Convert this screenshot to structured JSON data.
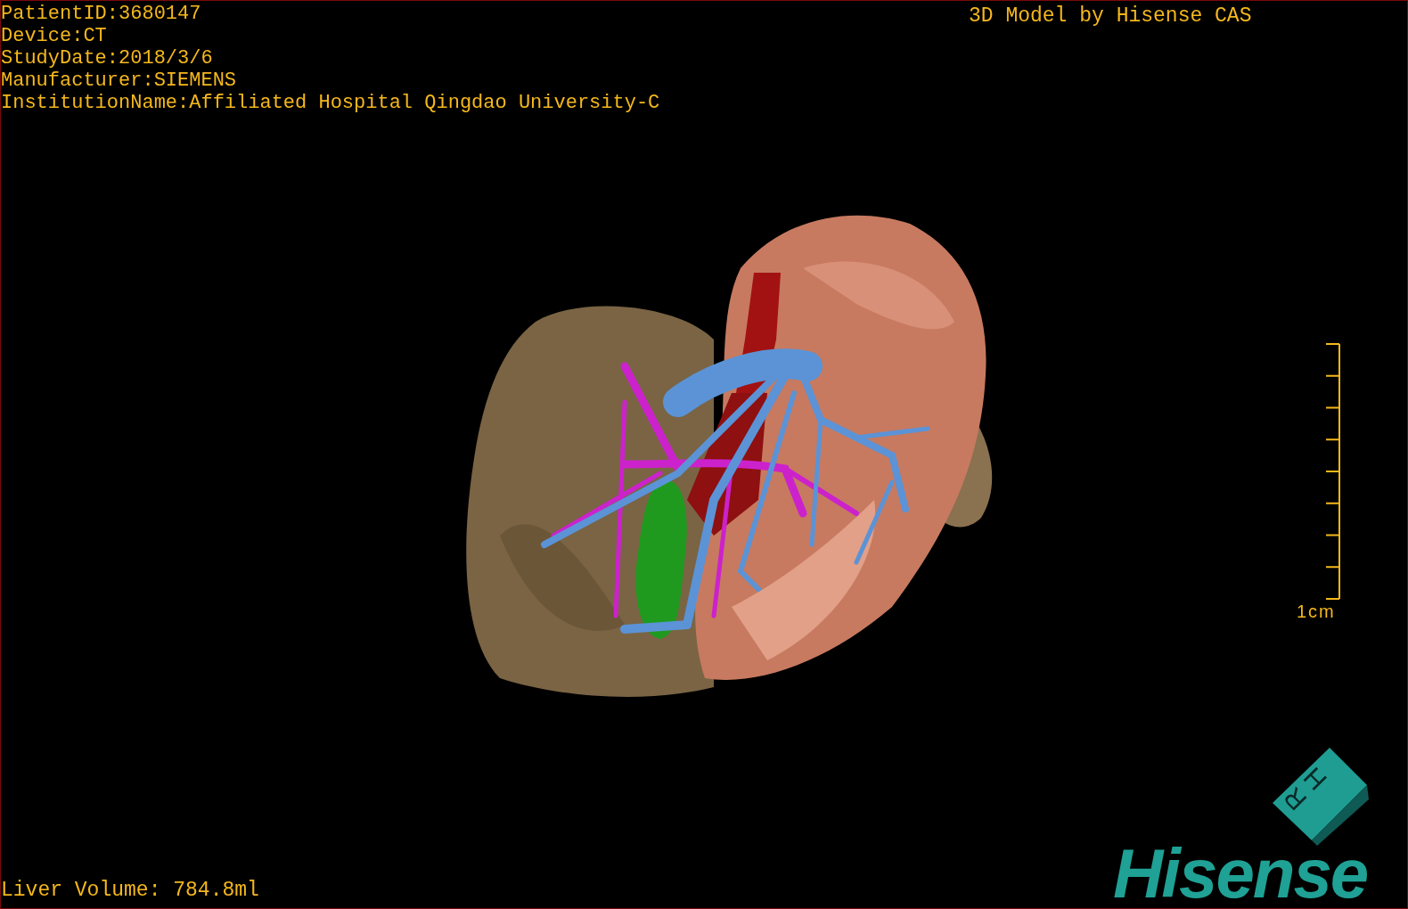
{
  "patient_info": [
    "PatientID:3680147",
    "Device:CT",
    "StudyDate:2018/3/6",
    "Manufacturer:SIEMENS",
    "InstitutionName:Affiliated Hospital Qingdao University-C"
  ],
  "model_credit": "3D Model by Hisense CAS",
  "scale_bar": {
    "label": "1cm"
  },
  "liver_volume": "Liver Volume: 784.8ml",
  "orientation_cube": {
    "faces": [
      "H",
      "R"
    ]
  },
  "logo": "Hisense"
}
